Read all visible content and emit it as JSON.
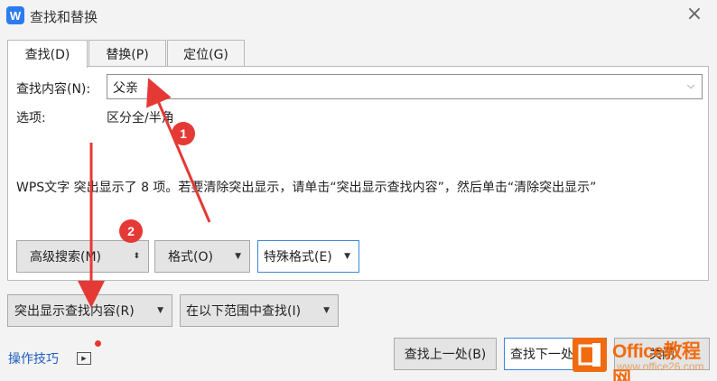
{
  "window": {
    "app_icon": "W",
    "title": "查找和替换",
    "close_glyph": "×"
  },
  "tabs": [
    {
      "label": "查找(D)",
      "active": true
    },
    {
      "label": "替换(P)",
      "active": false
    },
    {
      "label": "定位(G)",
      "active": false
    }
  ],
  "find": {
    "label": "查找内容(N):",
    "value": "父亲",
    "dropdown_glyph": "⌵"
  },
  "options": {
    "label": "选项:",
    "value": "区分全/半角"
  },
  "status_message": "WPS文字 突出显示了 8 项。若要清除突出显示，请单击“突出显示查找内容”，然后单击“清除突出显示”",
  "buttons": {
    "advanced_search": "高级搜索(M)",
    "format": "格式(O)",
    "special_format": "特殊格式(E)",
    "highlight_find": "突出显示查找内容(R)",
    "find_in": "在以下范围中查找(I)",
    "find_previous": "查找上一处(B)",
    "find_next": "查找下一处(F)",
    "close": "关闭"
  },
  "footer": {
    "tips_link": "操作技巧"
  },
  "annotations": {
    "badge_1": "1",
    "badge_2": "2",
    "color": "#e53935"
  },
  "watermark": {
    "name": "Office教程网",
    "url": "www.office26.com",
    "color": "#f06b10"
  }
}
